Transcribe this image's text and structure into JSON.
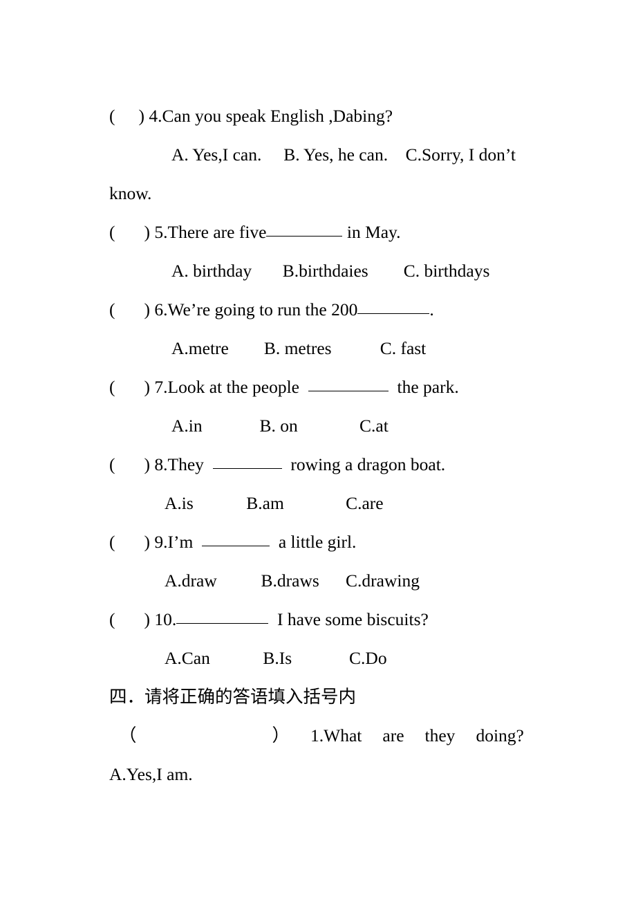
{
  "document": {
    "type": "english-exam-worksheet-page",
    "language_mix": "English with Chinese section heading"
  },
  "multiple_choice": {
    "questions": [
      {
        "bracket_open": "(",
        "bracket_close": ")",
        "number": "4.",
        "stem": "Can you speak English ,Dabing?",
        "stem_parts": {
          "before": "Can you speak English ,Dabing?",
          "blank": false,
          "after": ""
        },
        "options_text": "A. Yes,I can.     B. Yes, he can.    C.Sorry, I don’t",
        "options_wrap": "know.",
        "options": [
          "A. Yes,I can.",
          "B. Yes, he can.",
          "C.Sorry, I don’t know."
        ]
      },
      {
        "bracket_open": "(",
        "bracket_close": ")",
        "number": "5.",
        "stem_before": "There are five",
        "stem_after": " in May.",
        "options_text": "A. birthday       B.birthdaies        C. birthdays",
        "options": [
          "A. birthday",
          "B.birthdaies",
          "C. birthdays"
        ]
      },
      {
        "bracket_open": "(",
        "bracket_close": ")",
        "number": "6.",
        "stem_before": "We’re going to run the 200",
        "stem_after": ".",
        "options_text": "A.metre        B. metres           C. fast",
        "options": [
          "A.metre",
          "B. metres",
          "C. fast"
        ]
      },
      {
        "bracket_open": "(",
        "bracket_close": ")",
        "number": "7.",
        "stem_before": "Look at the people  ",
        "stem_after": "  the park.",
        "options_text": "A.in             B. on              C.at",
        "options": [
          "A.in",
          "B. on",
          "C.at"
        ]
      },
      {
        "bracket_open": "(",
        "bracket_close": ")",
        "number": "8.",
        "stem_before": "They  ",
        "stem_after": "  rowing a dragon boat.",
        "options_text": "A.is            B.am              C.are",
        "options": [
          "A.is",
          "B.am",
          "C.are"
        ]
      },
      {
        "bracket_open": "(",
        "bracket_close": ")",
        "number": "9.",
        "stem_before": "I’m  ",
        "stem_after": "  a little girl.",
        "options_text": "A.draw          B.draws      C.drawing",
        "options": [
          "A.draw",
          "B.draws",
          "C.drawing"
        ]
      },
      {
        "bracket_open": "(",
        "bracket_close": ")",
        "number": "10.",
        "stem_before": "",
        "stem_after": "  I have some biscuits?",
        "options_text": "A.Can            B.Is             C.Do",
        "options": [
          "A.Can",
          "B.Is",
          "C.Do"
        ]
      }
    ]
  },
  "section_four": {
    "heading": "四．请将正确的答语填入括号内",
    "items": [
      {
        "paren_open": "（",
        "paren_close": "）",
        "number": "1.",
        "words": [
          "1.What",
          "are",
          "they",
          "doing?"
        ],
        "question": "1.What are they doing?"
      }
    ],
    "answer_choices": [
      {
        "label": "A.Yes,I am.",
        "text": "A.Yes,I am."
      }
    ]
  }
}
